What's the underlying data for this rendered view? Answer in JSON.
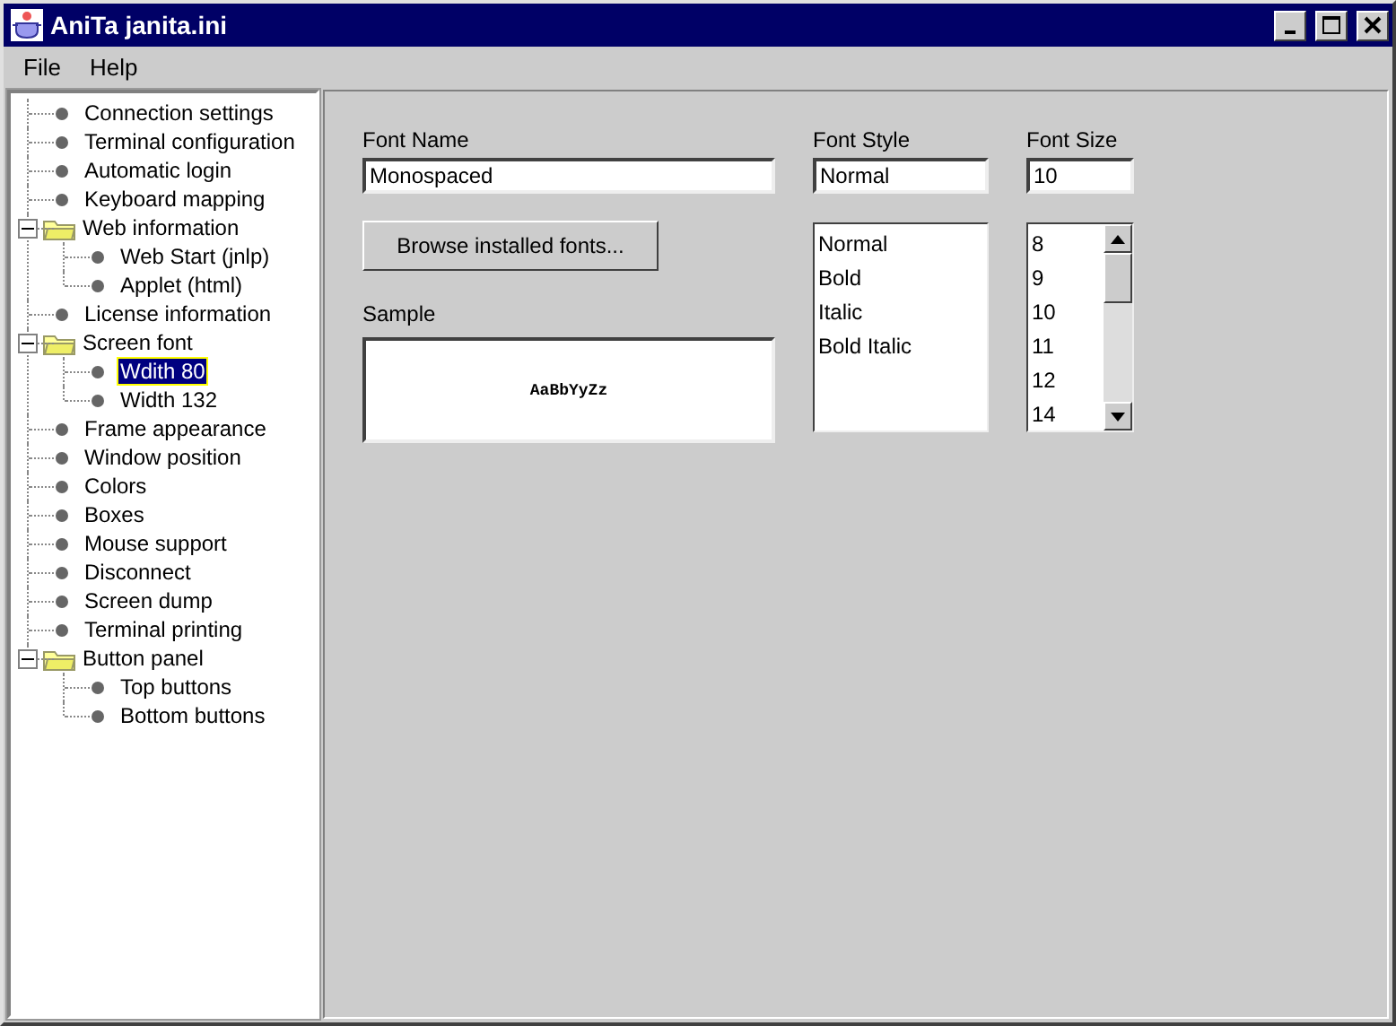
{
  "window": {
    "title": "AniTa janita.ini"
  },
  "menu": [
    "File",
    "Help"
  ],
  "tree": [
    {
      "label": "Connection settings",
      "selected": false
    },
    {
      "label": "Terminal configuration",
      "selected": false
    },
    {
      "label": "Automatic login",
      "selected": false
    },
    {
      "label": "Keyboard mapping",
      "selected": false
    },
    {
      "label": "Web information",
      "selected": false,
      "expanded": true,
      "children": [
        {
          "label": "Web Start (jnlp)",
          "selected": false
        },
        {
          "label": "Applet (html)",
          "selected": false
        }
      ]
    },
    {
      "label": "License information",
      "selected": false
    },
    {
      "label": "Screen font",
      "selected": false,
      "expanded": true,
      "children": [
        {
          "label": "Wdith 80",
          "selected": true
        },
        {
          "label": "Width 132",
          "selected": false
        }
      ]
    },
    {
      "label": "Frame appearance",
      "selected": false
    },
    {
      "label": "Window position",
      "selected": false
    },
    {
      "label": "Colors",
      "selected": false
    },
    {
      "label": "Boxes",
      "selected": false
    },
    {
      "label": "Mouse support",
      "selected": false
    },
    {
      "label": "Disconnect",
      "selected": false
    },
    {
      "label": "Screen dump",
      "selected": false
    },
    {
      "label": "Terminal printing",
      "selected": false
    },
    {
      "label": "Button panel",
      "selected": false,
      "expanded": true,
      "children": [
        {
          "label": "Top buttons",
          "selected": false
        },
        {
          "label": "Bottom buttons",
          "selected": false
        }
      ]
    }
  ],
  "font_name": {
    "label": "Font Name",
    "value": "Monospaced"
  },
  "browse_button": "Browse installed fonts...",
  "sample": {
    "label": "Sample",
    "text": "AaBbYyZz"
  },
  "font_style": {
    "label": "Font Style",
    "value": "Normal",
    "options": [
      "Normal",
      "Bold",
      "Italic",
      "Bold Italic"
    ]
  },
  "font_size": {
    "label": "Font Size",
    "value": "10",
    "options": [
      "8",
      "9",
      "10",
      "11",
      "12",
      "14"
    ]
  }
}
